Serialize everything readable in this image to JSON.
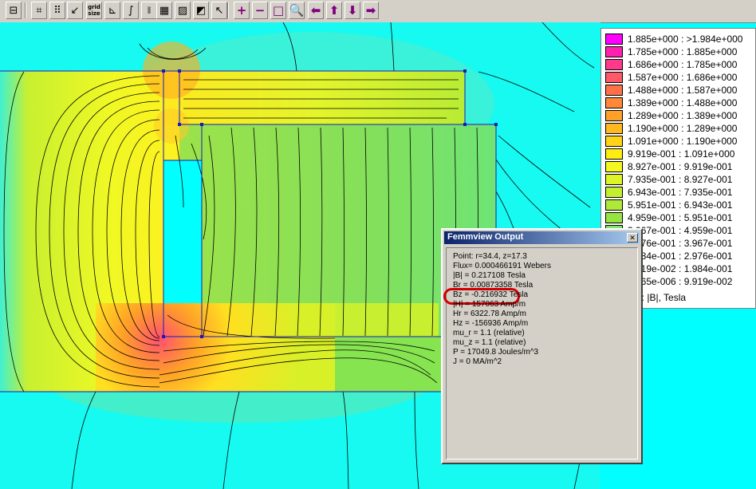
{
  "toolbar": {
    "buttons": [
      {
        "name": "show-mesh-button",
        "glyph": "⊟"
      },
      {
        "name": "snap-grid-button",
        "glyph": "⌗"
      },
      {
        "name": "show-grid-button",
        "glyph": "⠿"
      },
      {
        "name": "set-grid-button",
        "glyph": "↙"
      },
      {
        "name": "grid-size-button",
        "glyph": "grid size"
      },
      {
        "name": "plot-x-y-button",
        "glyph": "⊾"
      },
      {
        "name": "integrate-button",
        "glyph": "∫"
      },
      {
        "name": "line-integral-button",
        "glyph": "⧚"
      },
      {
        "name": "point-mode-button",
        "glyph": "▦"
      },
      {
        "name": "contour-mode-button",
        "glyph": "▨"
      },
      {
        "name": "area-mode-button",
        "glyph": "◩"
      },
      {
        "name": "select-pointer-button",
        "glyph": "↖"
      },
      {
        "name": "zoom-in-button",
        "glyph": "+"
      },
      {
        "name": "zoom-out-button",
        "glyph": "−"
      },
      {
        "name": "zoom-natural-button",
        "glyph": "□"
      },
      {
        "name": "zoom-window-button",
        "glyph": "🔍"
      },
      {
        "name": "pan-left-button",
        "glyph": "⬅"
      },
      {
        "name": "pan-up-button",
        "glyph": "⬆"
      },
      {
        "name": "pan-down-button",
        "glyph": "⬇"
      },
      {
        "name": "pan-right-button",
        "glyph": "➡"
      }
    ]
  },
  "legend": {
    "rows": [
      {
        "label": "1.885e+000 : >1.984e+000",
        "color": "#ff00ff"
      },
      {
        "label": "1.785e+000 : 1.885e+000",
        "color": "#ff20b0"
      },
      {
        "label": "1.686e+000 : 1.785e+000",
        "color": "#ff3a8a"
      },
      {
        "label": "1.587e+000 : 1.686e+000",
        "color": "#ff5868"
      },
      {
        "label": "1.488e+000 : 1.587e+000",
        "color": "#ff7048"
      },
      {
        "label": "1.389e+000 : 1.488e+000",
        "color": "#ff8838"
      },
      {
        "label": "1.289e+000 : 1.389e+000",
        "color": "#ffa028"
      },
      {
        "label": "1.190e+000 : 1.289e+000",
        "color": "#ffb820"
      },
      {
        "label": "1.091e+000 : 1.190e+000",
        "color": "#ffd418"
      },
      {
        "label": "9.919e-001 : 1.091e+000",
        "color": "#ffec10"
      },
      {
        "label": "8.927e-001 : 9.919e-001",
        "color": "#f4f820"
      },
      {
        "label": "7.935e-001 : 8.927e-001",
        "color": "#dcf428"
      },
      {
        "label": "6.943e-001 : 7.935e-001",
        "color": "#c4ee30"
      },
      {
        "label": "5.951e-001 : 6.943e-001",
        "color": "#aee838"
      },
      {
        "label": "4.959e-001 : 5.951e-001",
        "color": "#96e440"
      },
      {
        "label": "3.967e-001 : 4.959e-001",
        "color": "#7ee668"
      },
      {
        "label": "2.976e-001 : 3.967e-001",
        "color": "#62e890"
      },
      {
        "label": "1.984e-001 : 2.976e-001",
        "color": "#46ecb8"
      },
      {
        "label": "9.919e-002 : 1.984e-001",
        "color": "#28f4dc"
      },
      {
        "label": "1.165e-006 : 9.919e-002",
        "color": "#00ffff"
      }
    ],
    "visible_text": [
      "1.885e+000 : >1.984e+000",
      "1.785e+000 : 1.885e+000",
      "1.686e+000 : 1.785e+000",
      "1.587e+000 : 1.686e+000",
      "1.488e+000 : 1.587e+000",
      "1.389e+000 : 1.488e+000",
      "1.289e+000 : 1.389e+000",
      "1.190e+000 : 1.289e+000",
      "1.091e+000 : 1.190e+000",
      "9.919e-001 : 1.091e+000",
      "8.927e-001 : 9.919e-001",
      "7.935e-001 : 8.927e-001",
      "6.943e-001 : 7.935e-001",
      "5.951e-001 : 6.943e-001",
      "4.959e-001 : 5.951e-001",
      "67e-001 : 4.959e-001",
      "76e-001 : 3.967e-001",
      "34e-001 : 2.976e-001",
      "19e-002 : 1.984e-001",
      "165e-006 : 9.919e-002"
    ],
    "caption": "Plot: |B|, Tesla"
  },
  "output_window": {
    "title": "Femmview Output",
    "close_glyph": "✕",
    "lines": [
      "Point: r=34.4, z=17.3",
      "Flux= 0.000466191 Webers",
      "|B| = 0.217108 Tesla",
      "Br = 0.00873358 Tesla",
      "Bz = -0.216932 Tesla",
      "|H| = 157063 Amp/m",
      "Hr = 6322.78 Amp/m",
      "Hz = -156936 Amp/m",
      "mu_r = 1.1 (relative)",
      "mu_z = 1.1 (relative)",
      "P = 17049.8 Joules/m^3",
      "J = 0 MA/m^2"
    ]
  }
}
